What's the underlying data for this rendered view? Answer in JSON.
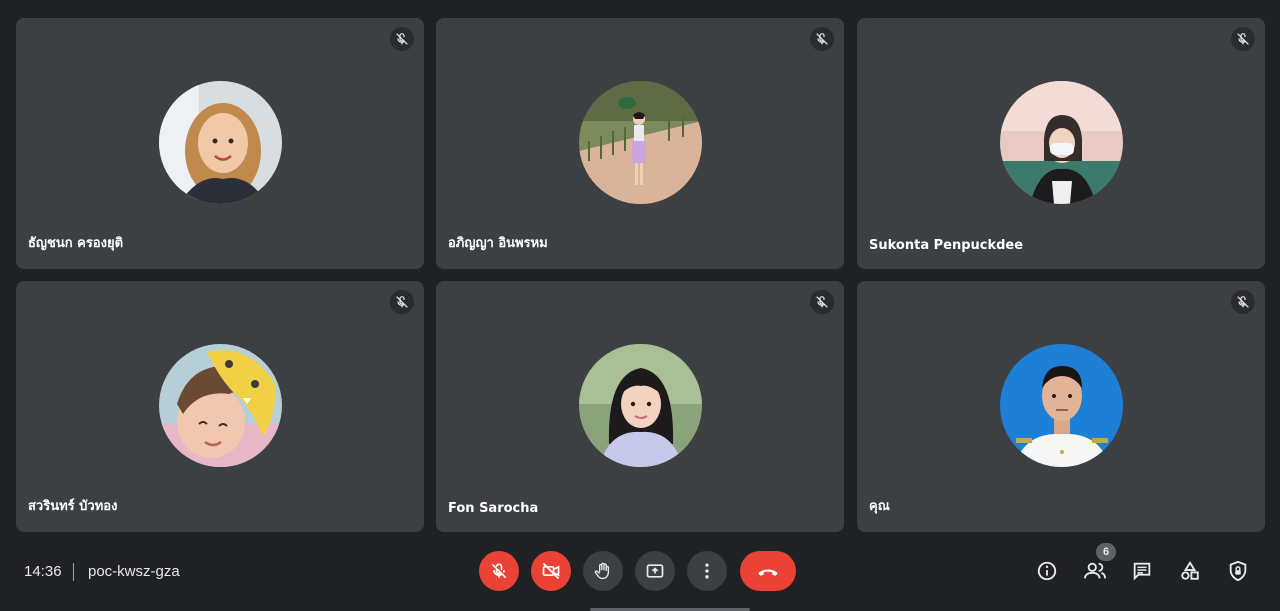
{
  "participants": [
    {
      "name": "ธัญชนก ครองยุติ",
      "muted": true
    },
    {
      "name": "อภิญญา อินพรหม",
      "muted": true
    },
    {
      "name": "Sukonta Penpuckdee",
      "muted": true
    },
    {
      "name": "สวรินทร์ บัวทอง",
      "muted": true
    },
    {
      "name": "Fon Sarocha",
      "muted": true
    },
    {
      "name": "คุณ",
      "muted": true
    }
  ],
  "meeting": {
    "time": "14:36",
    "code": "poc-kwsz-gza"
  },
  "controls": {
    "mic": "mic-off",
    "camera": "camera-off",
    "raise_hand": "raise-hand",
    "present": "present-now",
    "more": "more-options",
    "leave": "leave-call"
  },
  "side_controls": {
    "people_count": "6",
    "icons": [
      "info-icon",
      "people-icon",
      "chat-icon",
      "activities-icon",
      "host-controls-icon"
    ]
  },
  "colors": {
    "background": "#202124",
    "tile": "#3c4043",
    "danger": "#ea4335"
  }
}
